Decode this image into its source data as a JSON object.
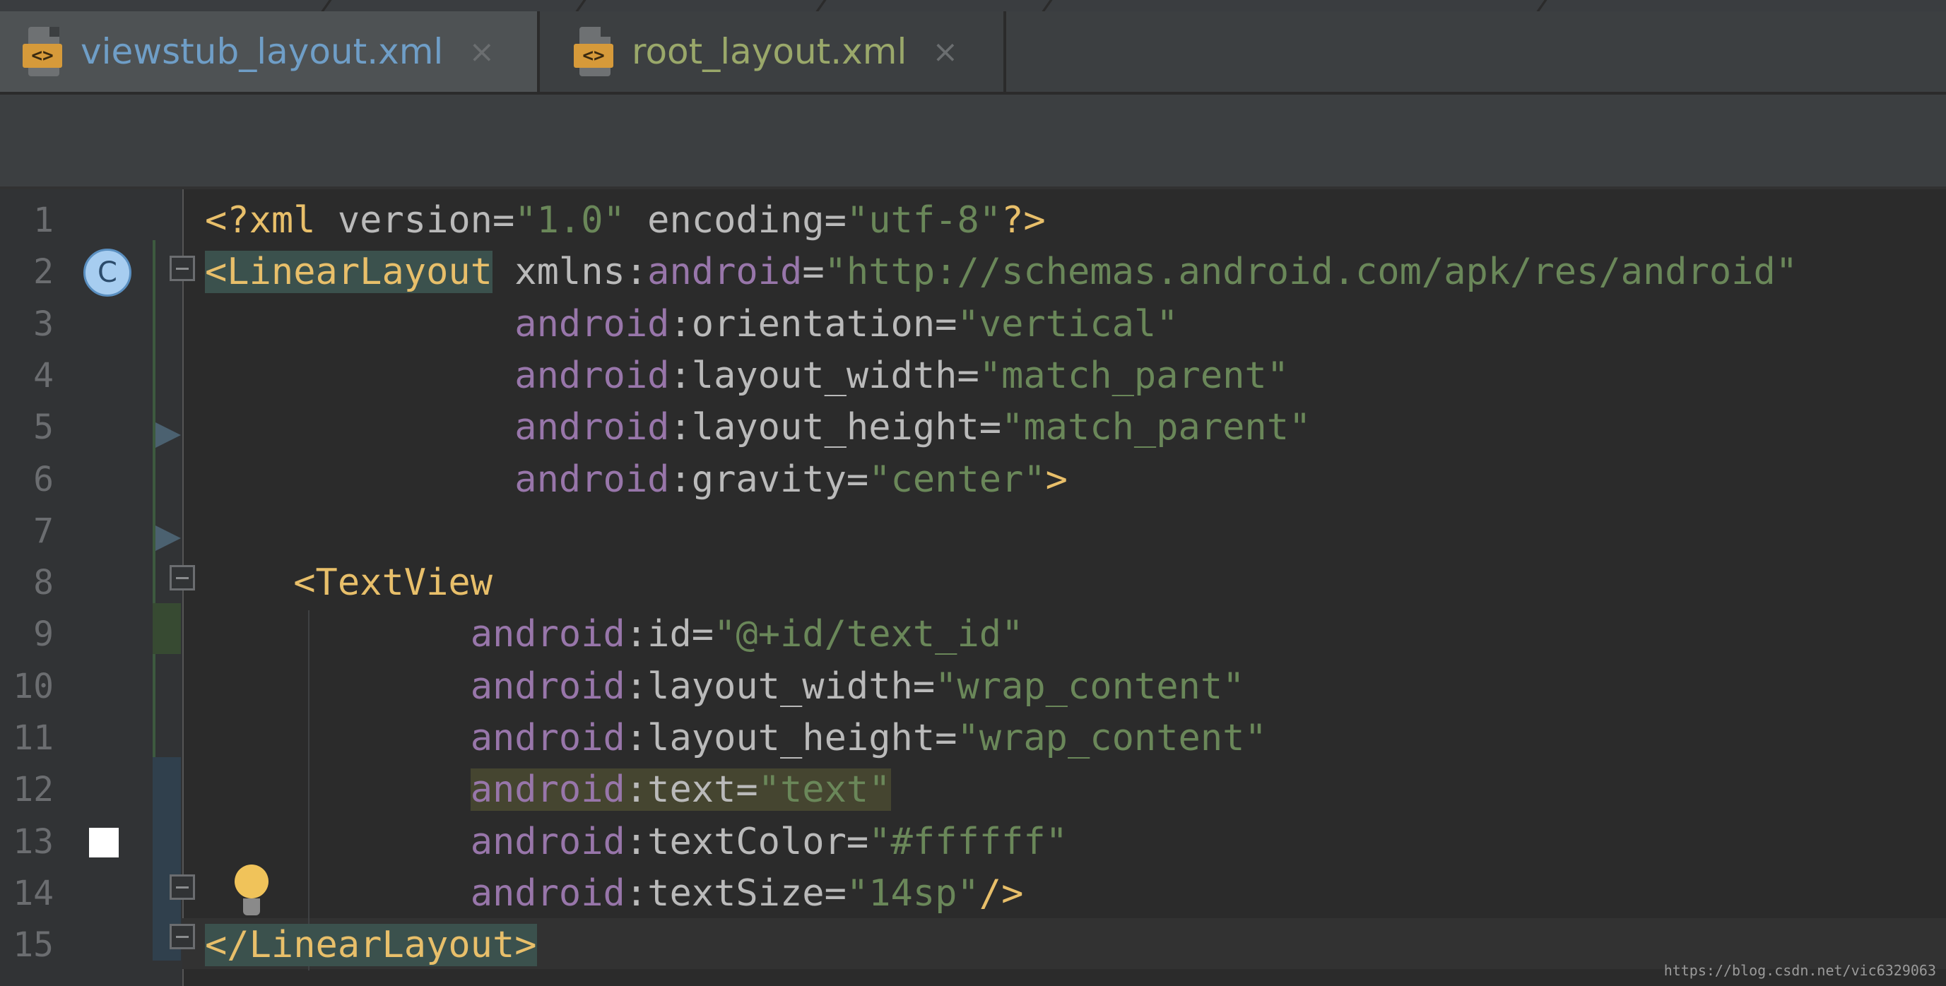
{
  "tabs": [
    {
      "label": "viewstub_layout.xml",
      "active": true,
      "icon": "xml-file-icon"
    },
    {
      "label": "root_layout.xml",
      "active": false,
      "icon": "xml-file-icon"
    }
  ],
  "close_glyph": "×",
  "editor": {
    "line_numbers": [
      "1",
      "2",
      "3",
      "4",
      "5",
      "6",
      "7",
      "8",
      "9",
      "10",
      "11",
      "12",
      "13",
      "14",
      "15"
    ],
    "code_lines": [
      [
        {
          "t": "<?xml ",
          "c": "pi"
        },
        {
          "t": "version=",
          "c": "attr"
        },
        {
          "t": "\"1.0\"",
          "c": "val"
        },
        {
          "t": " encoding=",
          "c": "attr"
        },
        {
          "t": "\"utf-8\"",
          "c": "val"
        },
        {
          "t": "?>",
          "c": "pi"
        }
      ],
      [
        {
          "t": "<LinearLayout",
          "c": "tag",
          "hl": "tag"
        },
        {
          "t": " xmlns:",
          "c": "attr"
        },
        {
          "t": "android",
          "c": "ns"
        },
        {
          "t": "=",
          "c": "attr"
        },
        {
          "t": "\"http://schemas.android.com/apk/res/android\"",
          "c": "val"
        }
      ],
      [
        {
          "t": "              ",
          "c": "attr"
        },
        {
          "t": "android",
          "c": "ns"
        },
        {
          "t": ":orientation=",
          "c": "attr"
        },
        {
          "t": "\"vertical\"",
          "c": "val"
        }
      ],
      [
        {
          "t": "              ",
          "c": "attr"
        },
        {
          "t": "android",
          "c": "ns"
        },
        {
          "t": ":layout_width=",
          "c": "attr"
        },
        {
          "t": "\"match_parent\"",
          "c": "val"
        }
      ],
      [
        {
          "t": "              ",
          "c": "attr"
        },
        {
          "t": "android",
          "c": "ns"
        },
        {
          "t": ":layout_height=",
          "c": "attr"
        },
        {
          "t": "\"match_parent\"",
          "c": "val"
        }
      ],
      [
        {
          "t": "              ",
          "c": "attr"
        },
        {
          "t": "android",
          "c": "ns"
        },
        {
          "t": ":gravity=",
          "c": "attr"
        },
        {
          "t": "\"center\"",
          "c": "val"
        },
        {
          "t": ">",
          "c": "tag"
        }
      ],
      [],
      [
        {
          "t": "    ",
          "c": "attr"
        },
        {
          "t": "<TextView",
          "c": "tag"
        }
      ],
      [
        {
          "t": "            ",
          "c": "attr"
        },
        {
          "t": "android",
          "c": "ns"
        },
        {
          "t": ":id=",
          "c": "attr"
        },
        {
          "t": "\"@+id/text_id\"",
          "c": "val"
        }
      ],
      [
        {
          "t": "            ",
          "c": "attr"
        },
        {
          "t": "android",
          "c": "ns"
        },
        {
          "t": ":layout_width=",
          "c": "attr"
        },
        {
          "t": "\"wrap_content\"",
          "c": "val"
        }
      ],
      [
        {
          "t": "            ",
          "c": "attr"
        },
        {
          "t": "android",
          "c": "ns"
        },
        {
          "t": ":layout_height=",
          "c": "attr"
        },
        {
          "t": "\"wrap_content\"",
          "c": "val"
        }
      ],
      [
        {
          "t": "            ",
          "c": "attr"
        },
        {
          "t": "android",
          "c": "ns",
          "hl": "text"
        },
        {
          "t": ":text=",
          "c": "attr",
          "hl": "text"
        },
        {
          "t": "\"text\"",
          "c": "val",
          "hl": "text"
        }
      ],
      [
        {
          "t": "            ",
          "c": "attr"
        },
        {
          "t": "android",
          "c": "ns"
        },
        {
          "t": ":textColor=",
          "c": "attr"
        },
        {
          "t": "\"#ffffff\"",
          "c": "val"
        }
      ],
      [
        {
          "t": "            ",
          "c": "attr"
        },
        {
          "t": "android",
          "c": "ns"
        },
        {
          "t": ":textSize=",
          "c": "attr"
        },
        {
          "t": "\"14sp\"",
          "c": "val"
        },
        {
          "t": "/>",
          "c": "tag"
        }
      ],
      [
        {
          "t": "</LinearLayout>",
          "c": "tag",
          "hl": "tag"
        }
      ]
    ],
    "gutter_badge_label": "C"
  },
  "watermark": "https://blog.csdn.net/vic6329063",
  "colors": {
    "tag": "#e8bf6a",
    "attribute": "#bababa",
    "namespace": "#9876aa",
    "value": "#6a8759",
    "background": "#2b2b2b"
  }
}
